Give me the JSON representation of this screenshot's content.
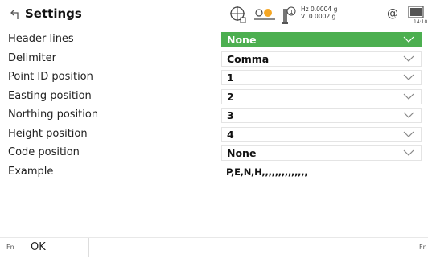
{
  "header": {
    "title": "Settings",
    "hz_line": "Hz 0.0004 g",
    "v_line": "V  0.0002 g",
    "at_symbol": "@",
    "time": "14:10",
    "prism_number": "1"
  },
  "rows": [
    {
      "label": "Header lines",
      "value": "None"
    },
    {
      "label": "Delimiter",
      "value": "Comma"
    },
    {
      "label": "Point ID position",
      "value": "1"
    },
    {
      "label": "Easting position",
      "value": "2"
    },
    {
      "label": "Northing position",
      "value": "3"
    },
    {
      "label": "Height position",
      "value": "4"
    },
    {
      "label": "Code position",
      "value": "None"
    }
  ],
  "example": {
    "label": "Example",
    "value": "P,E,N,H,,,,,,,,,,,,,,"
  },
  "bottom": {
    "fn_left": "Fn",
    "ok": "OK",
    "fn_right": "Fn"
  },
  "colors": {
    "highlight": "#4caf50",
    "accent_orange": "#f5a623"
  }
}
